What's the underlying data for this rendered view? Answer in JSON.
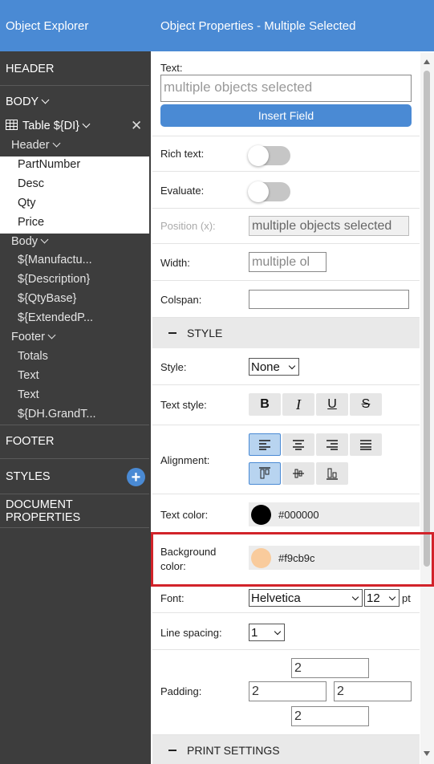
{
  "explorer": {
    "title": "Object Explorer",
    "header": "HEADER",
    "body": "BODY",
    "table": "Table ${DI}",
    "close_glyph": "✕",
    "header_group": "Header",
    "header_items": [
      "PartNumber",
      "Desc",
      "Qty",
      "Price"
    ],
    "body_group": "Body",
    "body_items": [
      "${Manufactu...",
      "${Description}",
      "${QtyBase}",
      "${ExtendedP..."
    ],
    "footer_group": "Footer",
    "footer_items": [
      "Totals",
      "Text",
      "Text",
      "${DH.GrandT..."
    ],
    "footer": "FOOTER",
    "styles": "STYLES",
    "document_properties": "DOCUMENT PROPERTIES",
    "add_glyph": "+"
  },
  "properties": {
    "title": "Object Properties - Multiple Selected",
    "text_label": "Text:",
    "text_placeholder": "multiple objects selected",
    "insert_field": "Insert Field",
    "rich_text_label": "Rich text:",
    "evaluate_label": "Evaluate:",
    "position_label": "Position (x):",
    "position_value": "multiple objects selected",
    "width_label": "Width:",
    "width_value": "multiple ol",
    "colspan_label": "Colspan:",
    "colspan_value": "",
    "style_section": "STYLE",
    "style_label": "Style:",
    "style_value": "None",
    "text_style_label": "Text style:",
    "text_style_buttons": [
      "B",
      "I",
      "U",
      "S"
    ],
    "alignment_label": "Alignment:",
    "text_color_label": "Text color:",
    "text_color_value": "#000000",
    "bg_color_label_1": "Background",
    "bg_color_label_2": "color:",
    "bg_color_value": "#f9cb9c",
    "font_label": "Font:",
    "font_value": "Helvetica",
    "font_size": "12",
    "font_unit": "pt",
    "line_spacing_label": "Line spacing:",
    "line_spacing_value": "1",
    "padding_label": "Padding:",
    "padding_top": "2",
    "padding_left": "2",
    "padding_right": "2",
    "padding_bottom": "2",
    "print_section": "PRINT SETTINGS"
  },
  "colors": {
    "accent": "#4a8ad4",
    "sidebar_bg": "#3d3d3d",
    "highlight": "#d2232a"
  }
}
